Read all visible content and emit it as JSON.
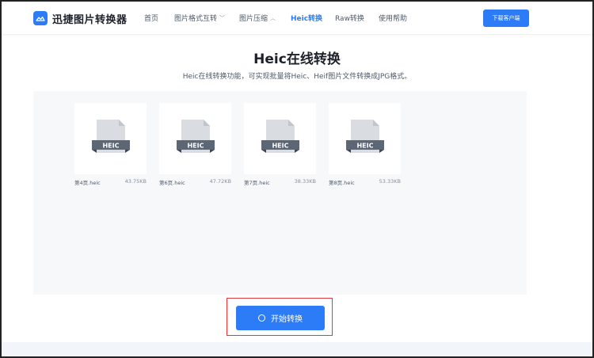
{
  "app": {
    "logo_text": "迅捷图片转换器"
  },
  "nav": {
    "items": [
      {
        "label": "首页",
        "dropdown": false,
        "active": false
      },
      {
        "label": "图片格式互转",
        "dropdown": true,
        "active": false
      },
      {
        "label": "图片压缩",
        "dropdown": true,
        "active": false
      },
      {
        "label": "Heic转换",
        "dropdown": false,
        "active": true
      },
      {
        "label": "Raw转换",
        "dropdown": false,
        "active": false
      },
      {
        "label": "使用帮助",
        "dropdown": false,
        "active": false
      }
    ],
    "download_label": "下载客户端"
  },
  "page": {
    "title": "Heic在线转换",
    "subtitle": "Heic在线转换功能，可实现批量将Heic、Heif图片文件转换成JPG格式。"
  },
  "files": [
    {
      "name": "第4页.heic",
      "size": "43.75KB",
      "badge": "HEIC"
    },
    {
      "name": "第6页.heic",
      "size": "47.72KB",
      "badge": "HEIC"
    },
    {
      "name": "第7页.heic",
      "size": "38.33KB",
      "badge": "HEIC"
    },
    {
      "name": "第8页.heic",
      "size": "53.33KB",
      "badge": "HEIC"
    }
  ],
  "actions": {
    "start_label": "开始转换"
  },
  "colors": {
    "accent": "#2b7cf6",
    "highlight": "#e0393e"
  }
}
